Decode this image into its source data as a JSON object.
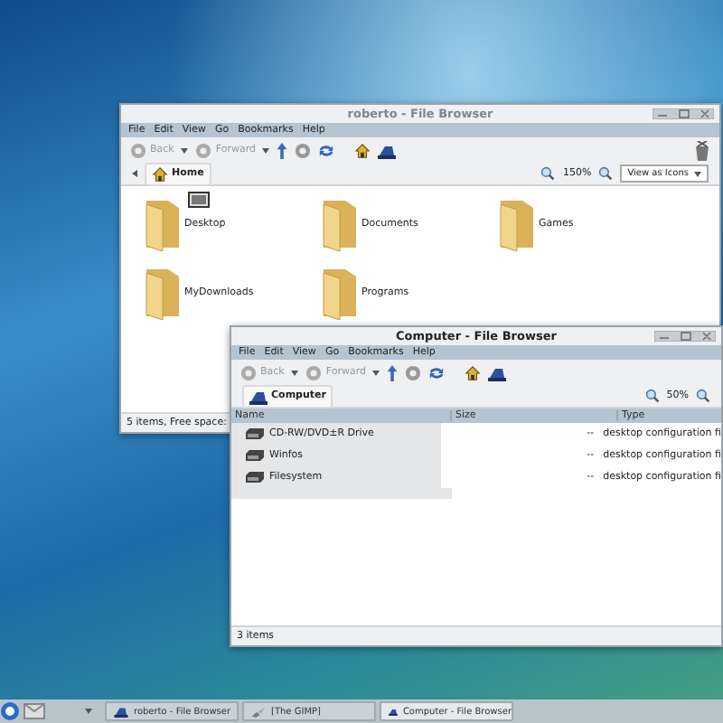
{
  "windows": [
    {
      "title": "roberto - File Browser",
      "active": false,
      "menu": [
        "File",
        "Edit",
        "View",
        "Go",
        "Bookmarks",
        "Help"
      ],
      "back": "Back",
      "forward": "Forward",
      "location": "Home",
      "location_back": true,
      "zoom": "150%",
      "view_mode": "View as Icons",
      "throbber": true,
      "content": {
        "kind": "icons",
        "items": [
          {
            "label": "Desktop",
            "emblem": true
          },
          {
            "label": "Documents"
          },
          {
            "label": "Games"
          },
          {
            "label": "MyDownloads"
          },
          {
            "label": "Programs"
          }
        ]
      },
      "status": "5 items, Free space:"
    },
    {
      "title": "Computer - File Browser",
      "active": true,
      "menu": [
        "File",
        "Edit",
        "View",
        "Go",
        "Bookmarks",
        "Help"
      ],
      "back": "Back",
      "forward": "Forward",
      "location": "Computer",
      "zoom": "50%",
      "content": {
        "kind": "list",
        "columns": [
          "Name",
          "Size",
          "Type"
        ],
        "rows": [
          {
            "name": "CD-RW/DVD±R Drive",
            "size": "--",
            "type": "desktop configuration fi"
          },
          {
            "name": "Winfos",
            "size": "--",
            "type": "desktop configuration fi"
          },
          {
            "name": "Filesystem",
            "size": "--",
            "type": "desktop configuration fi"
          }
        ]
      },
      "status": "3 items"
    }
  ],
  "taskbar": {
    "tasks": [
      {
        "label": "roberto - File Browser",
        "kind": "files",
        "selected": false
      },
      {
        "label": "[The GIMP]",
        "kind": "gimp",
        "selected": false
      },
      {
        "label": "Computer - File Browser",
        "kind": "files",
        "selected": true
      }
    ]
  }
}
